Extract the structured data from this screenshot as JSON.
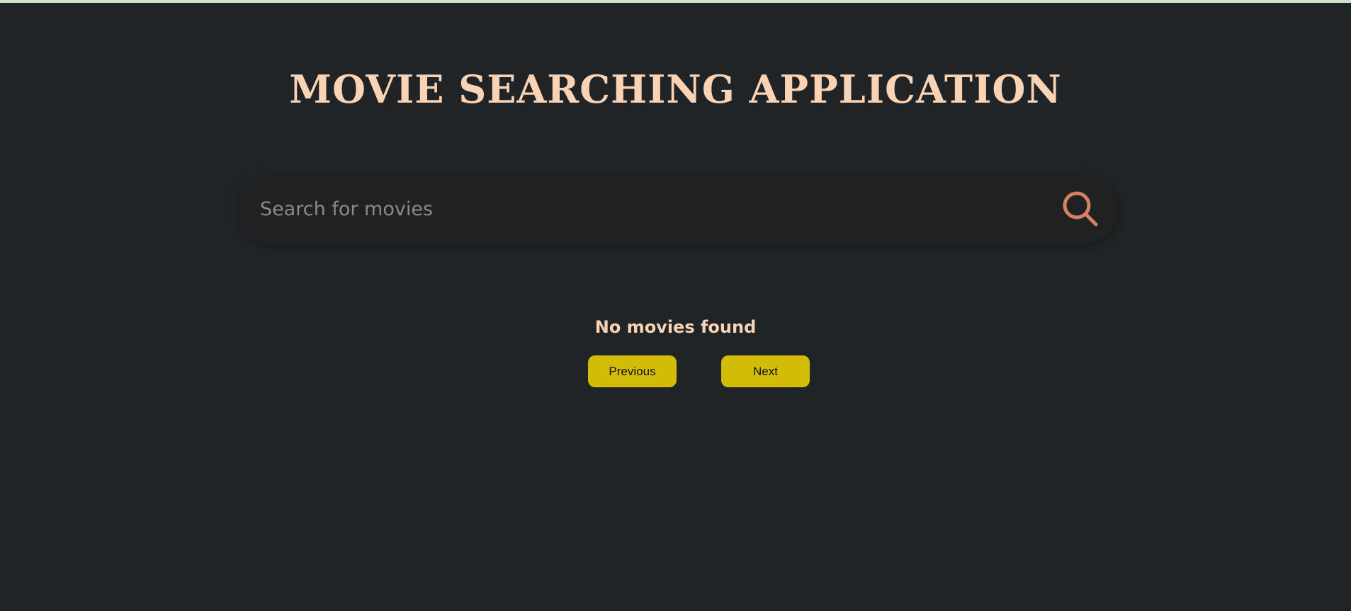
{
  "app": {
    "title": "MOVIE SEARCHING APPLICATION"
  },
  "search": {
    "placeholder": "Search for movies",
    "value": "",
    "icon": "search-icon"
  },
  "results": {
    "empty_message": "No movies found"
  },
  "pagination": {
    "previous_label": "Previous",
    "next_label": "Next"
  },
  "colors": {
    "background": "#212426",
    "title": "#f9d3b4",
    "accent_icon": "#d98060",
    "button": "#d3bc08"
  }
}
